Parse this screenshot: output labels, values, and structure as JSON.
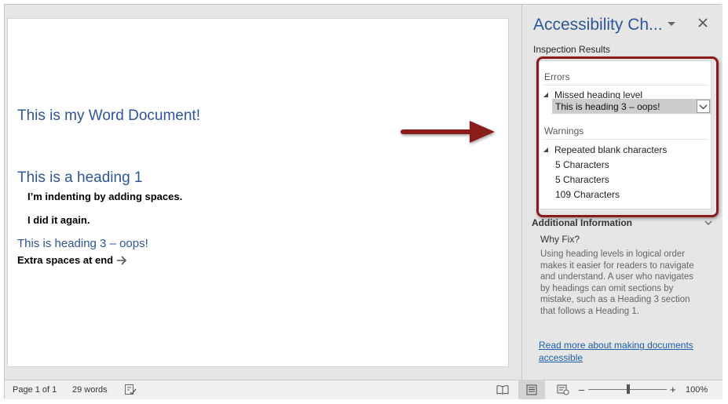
{
  "document": {
    "title": "This is my Word Document!",
    "heading1": "This is a heading 1",
    "para_indent": "I’m indenting by adding spaces.",
    "para_again": "I did it again.",
    "heading3": "This is heading 3 – oops!",
    "para_extra": "Extra spaces at end"
  },
  "pane": {
    "title": "Accessibility Ch...",
    "inspection_label": "Inspection Results",
    "errors_label": "Errors",
    "error_group": "Missed heading level",
    "error_item": "This is heading 3 – oops!",
    "warnings_label": "Warnings",
    "warning_group": "Repeated blank characters",
    "warning_items": [
      "5 Characters",
      "5 Characters",
      "109 Characters"
    ],
    "additional_label": "Additional Information",
    "why_fix_label": "Why Fix?",
    "why_fix_text": "Using heading levels in logical order makes it easier for readers to navigate and understand. A user who navigates by headings can omit sections by mistake, such as a Heading 3 section that follows a Heading 1.",
    "read_more_link": "Read more about making documents accessible"
  },
  "status_bar": {
    "page": "Page 1 of 1",
    "words": "29 words",
    "zoom_minus": "–",
    "zoom_plus": "+",
    "zoom_level": "100%"
  },
  "icons": {
    "pane_menu": "chevron-down-icon",
    "pane_close": "close-icon",
    "tab_arrow": "right-arrow-icon",
    "annotation": "red-arrow-icon",
    "proofing": "proofing-icon",
    "read_mode": "read-mode-icon",
    "print_layout": "print-layout-icon",
    "web_layout": "web-layout-icon"
  },
  "colors": {
    "heading_blue": "#2e5597",
    "annotation_red": "#8b1a1a",
    "link_blue": "#1f5fa8"
  }
}
